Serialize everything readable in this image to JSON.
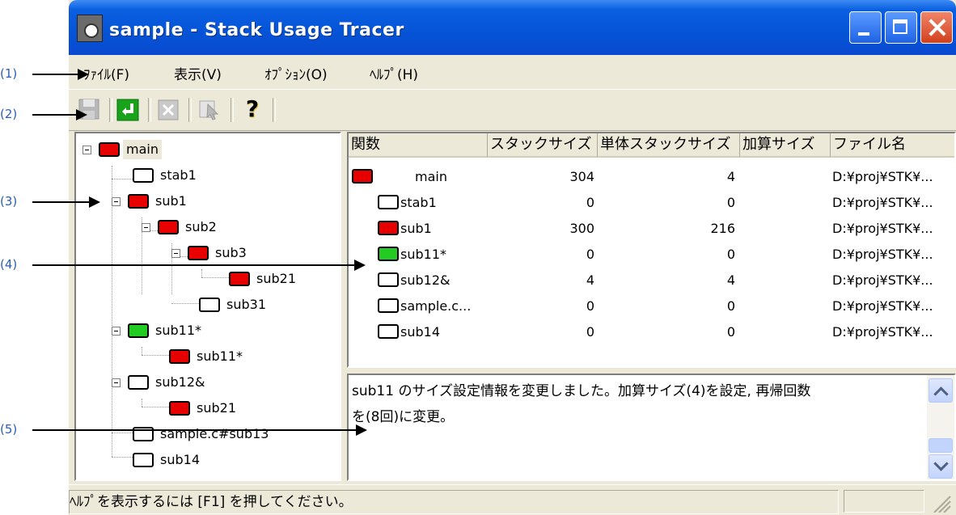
{
  "window": {
    "title": "sample - Stack Usage Tracer"
  },
  "menu": [
    "ﾌｧｲﾙ(F)",
    "表示(V)",
    "ｵﾌﾟｼｮﾝ(O)",
    "ﾍﾙﾌﾟ(H)"
  ],
  "toolbar": {
    "save_icon": "save-icon",
    "apply_icon": "enter-icon",
    "delete_icon": "x-icon",
    "tool_icon": "pointer-tool-icon",
    "help_icon": "help-question-icon",
    "help_glyph": "?"
  },
  "tree": [
    {
      "label": "main",
      "color": "red"
    },
    {
      "label": "stab1",
      "color": "white"
    },
    {
      "label": "sub1",
      "color": "red"
    },
    {
      "label": "sub2",
      "color": "red"
    },
    {
      "label": "sub3",
      "color": "red"
    },
    {
      "label": "sub21",
      "color": "red"
    },
    {
      "label": "sub31",
      "color": "white"
    },
    {
      "label": "sub11*",
      "color": "green"
    },
    {
      "label": "sub11*",
      "color": "red"
    },
    {
      "label": "sub12&",
      "color": "white"
    },
    {
      "label": "sub21",
      "color": "red"
    },
    {
      "label": "sample.c#sub13",
      "color": "white"
    },
    {
      "label": "sub14",
      "color": "white"
    }
  ],
  "table": {
    "headers": [
      "関数",
      "スタックサイズ",
      "単体スタックサイズ",
      "加算サイズ",
      "ファイル名"
    ],
    "rows": [
      {
        "name": "main",
        "color": "red",
        "stack": "304",
        "single": "4",
        "file": "D:¥proj¥STK¥..."
      },
      {
        "name": "stab1",
        "color": "white",
        "stack": "0",
        "single": "0",
        "file": "D:¥proj¥STK¥..."
      },
      {
        "name": "sub1",
        "color": "red",
        "stack": "300",
        "single": "216",
        "file": "D:¥proj¥STK¥..."
      },
      {
        "name": "sub11*",
        "color": "green",
        "stack": "0",
        "single": "0",
        "file": "D:¥proj¥STK¥..."
      },
      {
        "name": "sub12&",
        "color": "white",
        "stack": "4",
        "single": "4",
        "file": "D:¥proj¥STK¥..."
      },
      {
        "name": "sample.c...",
        "color": "white",
        "stack": "0",
        "single": "0",
        "file": "D:¥proj¥STK¥..."
      },
      {
        "name": "sub14",
        "color": "white",
        "stack": "0",
        "single": "0",
        "file": "D:¥proj¥STK¥..."
      }
    ]
  },
  "message": {
    "line1": "sub11 のサイズ設定情報を変更しました。加算サイズ(4)を設定, 再帰回数",
    "line2": "を(8回)に変更。"
  },
  "status": {
    "text": "ﾍﾙﾌﾟを表示するには [F1] を押してください。"
  },
  "callouts": [
    "(1)",
    "(2)",
    "(3)",
    "(4)",
    "(5)"
  ],
  "colors": {
    "red": "#e80000",
    "green": "#22cc22",
    "white": "#ffffff",
    "titlebar": "#0553d6",
    "callout": "#2b5fb3"
  }
}
